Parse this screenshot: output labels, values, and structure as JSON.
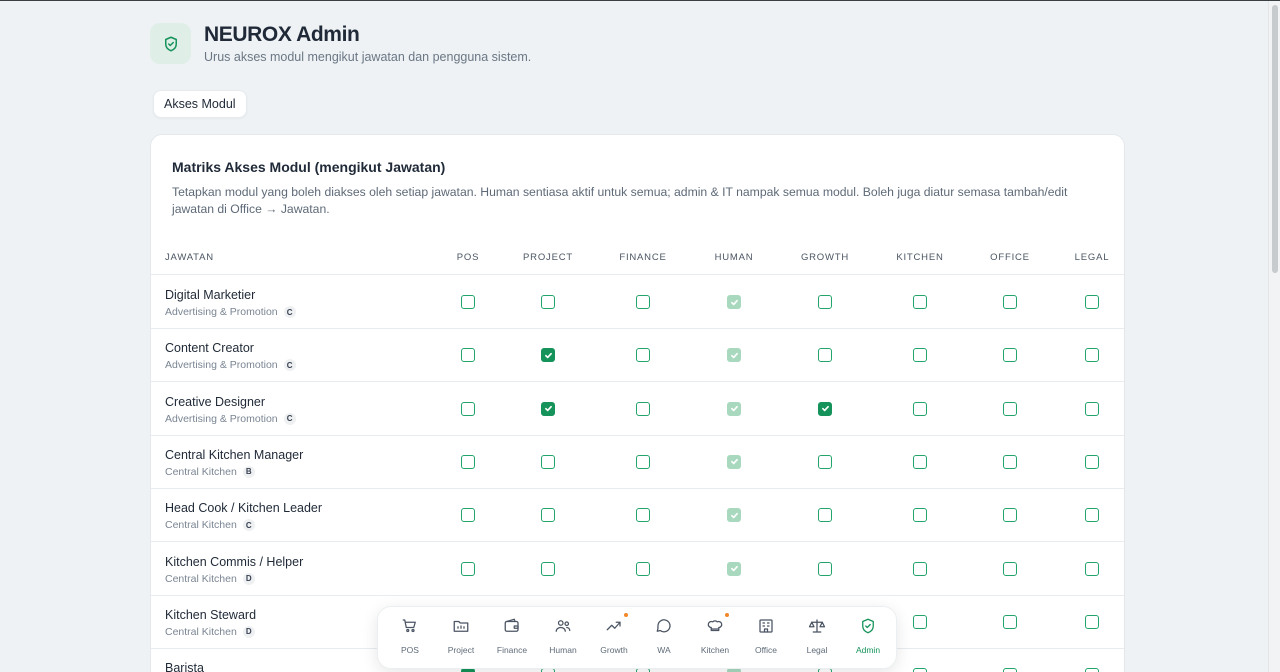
{
  "app": {
    "title": "NEUROX Admin",
    "subtitle": "Urus akses modul mengikut jawatan dan pengguna sistem."
  },
  "tab": {
    "label": "Akses Modul"
  },
  "card": {
    "title": "Matriks Akses Modul (mengikut Jawatan)",
    "description": "Tetapkan modul yang boleh diakses oleh setiap jawatan. Human sentiasa aktif untuk semua; admin & IT nampak semua modul. Boleh juga diatur semasa tambah/edit jawatan di Office → Jawatan."
  },
  "table": {
    "columns": [
      "JAWATAN",
      "POS",
      "PROJECT",
      "FINANCE",
      "HUMAN",
      "GROWTH",
      "KITCHEN",
      "OFFICE",
      "LEGAL"
    ],
    "rows": [
      {
        "name": "Digital Marketier",
        "dept": "Advertising & Promotion",
        "grade": "C",
        "access": [
          false,
          false,
          false,
          "locked",
          false,
          false,
          false,
          false
        ]
      },
      {
        "name": "Content Creator",
        "dept": "Advertising & Promotion",
        "grade": "C",
        "access": [
          false,
          true,
          false,
          "locked",
          false,
          false,
          false,
          false
        ]
      },
      {
        "name": "Creative Designer",
        "dept": "Advertising & Promotion",
        "grade": "C",
        "access": [
          false,
          true,
          false,
          "locked",
          true,
          false,
          false,
          false
        ]
      },
      {
        "name": "Central Kitchen Manager",
        "dept": "Central Kitchen",
        "grade": "B",
        "access": [
          false,
          false,
          false,
          "locked",
          false,
          false,
          false,
          false
        ]
      },
      {
        "name": "Head Cook / Kitchen Leader",
        "dept": "Central Kitchen",
        "grade": "C",
        "access": [
          false,
          false,
          false,
          "locked",
          false,
          false,
          false,
          false
        ]
      },
      {
        "name": "Kitchen Commis / Helper",
        "dept": "Central Kitchen",
        "grade": "D",
        "access": [
          false,
          false,
          false,
          "locked",
          false,
          false,
          false,
          false
        ]
      },
      {
        "name": "Kitchen Steward",
        "dept": "Central Kitchen",
        "grade": "D",
        "access": [
          false,
          false,
          false,
          "locked",
          false,
          false,
          false,
          false
        ]
      },
      {
        "name": "Barista",
        "dept": "",
        "grade": "",
        "access": [
          true,
          false,
          false,
          "locked",
          false,
          false,
          false,
          false
        ]
      }
    ]
  },
  "dock": {
    "items": [
      {
        "label": "POS",
        "icon": "cart-icon",
        "dot": false,
        "active": false
      },
      {
        "label": "Project",
        "icon": "folder-icon",
        "dot": false,
        "active": false
      },
      {
        "label": "Finance",
        "icon": "wallet-icon",
        "dot": false,
        "active": false
      },
      {
        "label": "Human",
        "icon": "users-icon",
        "dot": false,
        "active": false
      },
      {
        "label": "Growth",
        "icon": "trending-up-icon",
        "dot": true,
        "active": false
      },
      {
        "label": "WA",
        "icon": "chat-bubble-icon",
        "dot": false,
        "active": false
      },
      {
        "label": "Kitchen",
        "icon": "chef-hat-icon",
        "dot": true,
        "active": false
      },
      {
        "label": "Office",
        "icon": "building-icon",
        "dot": false,
        "active": false
      },
      {
        "label": "Legal",
        "icon": "scale-icon",
        "dot": false,
        "active": false
      },
      {
        "label": "Admin",
        "icon": "shield-check-icon",
        "dot": false,
        "active": true
      }
    ]
  },
  "colors": {
    "accent": "#15935a",
    "accent_light": "#a8d9bf",
    "background": "#eef2f4",
    "notification_dot": "#f0882a"
  }
}
